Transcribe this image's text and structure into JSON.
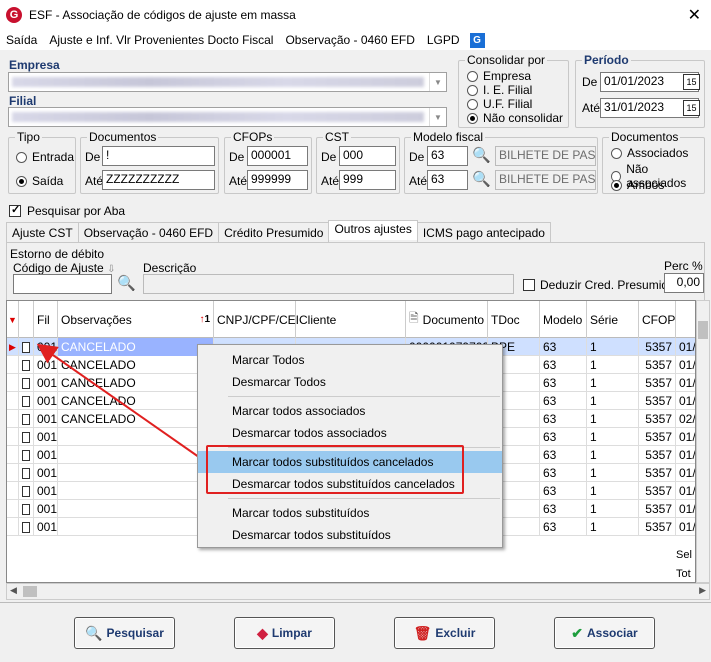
{
  "window": {
    "title": "ESF - Associação de códigos de ajuste em massa",
    "close": "✕"
  },
  "menu": {
    "items": [
      "Saída",
      "Ajuste e Inf. Vlr Provenientes Docto Fiscal",
      "Observação - 0460 EFD",
      "LGPD"
    ],
    "lgpd_icon": "G"
  },
  "empresa": {
    "label": "Empresa"
  },
  "filial": {
    "label": "Filial"
  },
  "consolidar": {
    "title": "Consolidar por",
    "options": [
      "Empresa",
      "I. E. Filial",
      "U.F. Filial",
      "Não consolidar"
    ],
    "selected": 3
  },
  "periodo": {
    "title": "Período",
    "de_label": "De",
    "ate_label": "Até",
    "de_value": "01/01/2023",
    "ate_value": "31/01/2023",
    "cal_icon": "15"
  },
  "tipo": {
    "title": "Tipo",
    "options": [
      "Entrada",
      "Saída"
    ],
    "selected": 1
  },
  "documentos": {
    "title": "Documentos",
    "de_label": "De",
    "ate_label": "Até",
    "de_value": "!",
    "ate_value": "ZZZZZZZZZZ"
  },
  "cfops": {
    "title": "CFOPs",
    "de_label": "De",
    "ate_label": "Até",
    "de_value": "000001",
    "ate_value": "999999"
  },
  "cst": {
    "title": "CST",
    "de_label": "De",
    "ate_label": "Até",
    "de_value": "000",
    "ate_value": "999"
  },
  "modelo": {
    "title": "Modelo fiscal",
    "de_label": "De",
    "ate_label": "Até",
    "de_value": "63",
    "ate_value": "63",
    "de_desc": "BILHETE DE PASS.",
    "ate_desc": "BILHETE DE PASS."
  },
  "docs_filter": {
    "title": "Documentos",
    "options": [
      "Associados",
      "Não associados",
      "Ambos"
    ],
    "selected": 2
  },
  "pesquisar_aba": {
    "label": "Pesquisar por Aba",
    "checked": true
  },
  "tabs": [
    "Ajuste CST",
    "Observação - 0460 EFD",
    "Crédito Presumido",
    "Outros ajustes",
    "ICMS pago antecipado"
  ],
  "active_tab": 3,
  "estorno": {
    "title": "Estorno de débito",
    "codigo_label": "Código de Ajuste",
    "descricao_label": "Descrição",
    "deduzir_label": "Deduzir Cred. Presumido",
    "perc_label": "Perc %",
    "perc_value": "0,00",
    "sort_icon": "⇩"
  },
  "grid": {
    "columns": [
      "Fil",
      "Observações",
      "CNPJ/CPF/CEI",
      "Cliente",
      "Documento",
      "TDoc",
      "Modelo",
      "Série",
      "CFOP"
    ],
    "sort_marker": "1",
    "rows": [
      {
        "fil": "001",
        "obs": "CANCELADO",
        "doc": "0000010797028",
        "tdoc": "BPE",
        "modelo": "63",
        "serie": "1",
        "cfop": "5357",
        "extra": "01/"
      },
      {
        "fil": "001",
        "obs": "CANCELADO",
        "doc": "",
        "tdoc": "E",
        "modelo": "63",
        "serie": "1",
        "cfop": "5357",
        "extra": "01/"
      },
      {
        "fil": "001",
        "obs": "CANCELADO",
        "doc": "",
        "tdoc": "E",
        "modelo": "63",
        "serie": "1",
        "cfop": "5357",
        "extra": "01/"
      },
      {
        "fil": "001",
        "obs": "CANCELADO",
        "doc": "",
        "tdoc": "E",
        "modelo": "63",
        "serie": "1",
        "cfop": "5357",
        "extra": "01/"
      },
      {
        "fil": "001",
        "obs": "CANCELADO",
        "doc": "",
        "tdoc": "E",
        "modelo": "63",
        "serie": "1",
        "cfop": "5357",
        "extra": "02/"
      },
      {
        "fil": "001",
        "obs": "",
        "doc": "",
        "tdoc": "E",
        "modelo": "63",
        "serie": "1",
        "cfop": "5357",
        "extra": "01/"
      },
      {
        "fil": "001",
        "obs": "",
        "doc": "",
        "tdoc": "E",
        "modelo": "63",
        "serie": "1",
        "cfop": "5357",
        "extra": "01/"
      },
      {
        "fil": "001",
        "obs": "",
        "doc": "",
        "tdoc": "E",
        "modelo": "63",
        "serie": "1",
        "cfop": "5357",
        "extra": "01/"
      },
      {
        "fil": "001",
        "obs": "",
        "doc": "",
        "tdoc": "E",
        "modelo": "63",
        "serie": "1",
        "cfop": "5357",
        "extra": "01/"
      },
      {
        "fil": "001",
        "obs": "",
        "doc": "",
        "tdoc": "E",
        "modelo": "63",
        "serie": "1",
        "cfop": "5357",
        "extra": "01/"
      },
      {
        "fil": "001",
        "obs": "",
        "doc": "",
        "tdoc": "E",
        "modelo": "63",
        "serie": "1",
        "cfop": "5357",
        "extra": "01/"
      }
    ],
    "footer": [
      "Sel",
      "Tot"
    ]
  },
  "context_menu": {
    "items": [
      "Marcar Todos",
      "Desmarcar Todos",
      "Marcar todos associados",
      "Desmarcar todos associados",
      "Marcar todos substituídos cancelados",
      "Desmarcar todos substituídos cancelados",
      "Marcar todos substituídos",
      "Desmarcar todos substituídos"
    ],
    "highlighted": 4
  },
  "buttons": {
    "pesquisar": "Pesquisar",
    "limpar": "Limpar",
    "excluir": "Excluir",
    "associar": "Associar"
  },
  "colors": {
    "accent": "#1e3a70",
    "selection": "#99b3ff",
    "highlight_box": "#e02020",
    "menu_hover": "#99c9ef"
  }
}
